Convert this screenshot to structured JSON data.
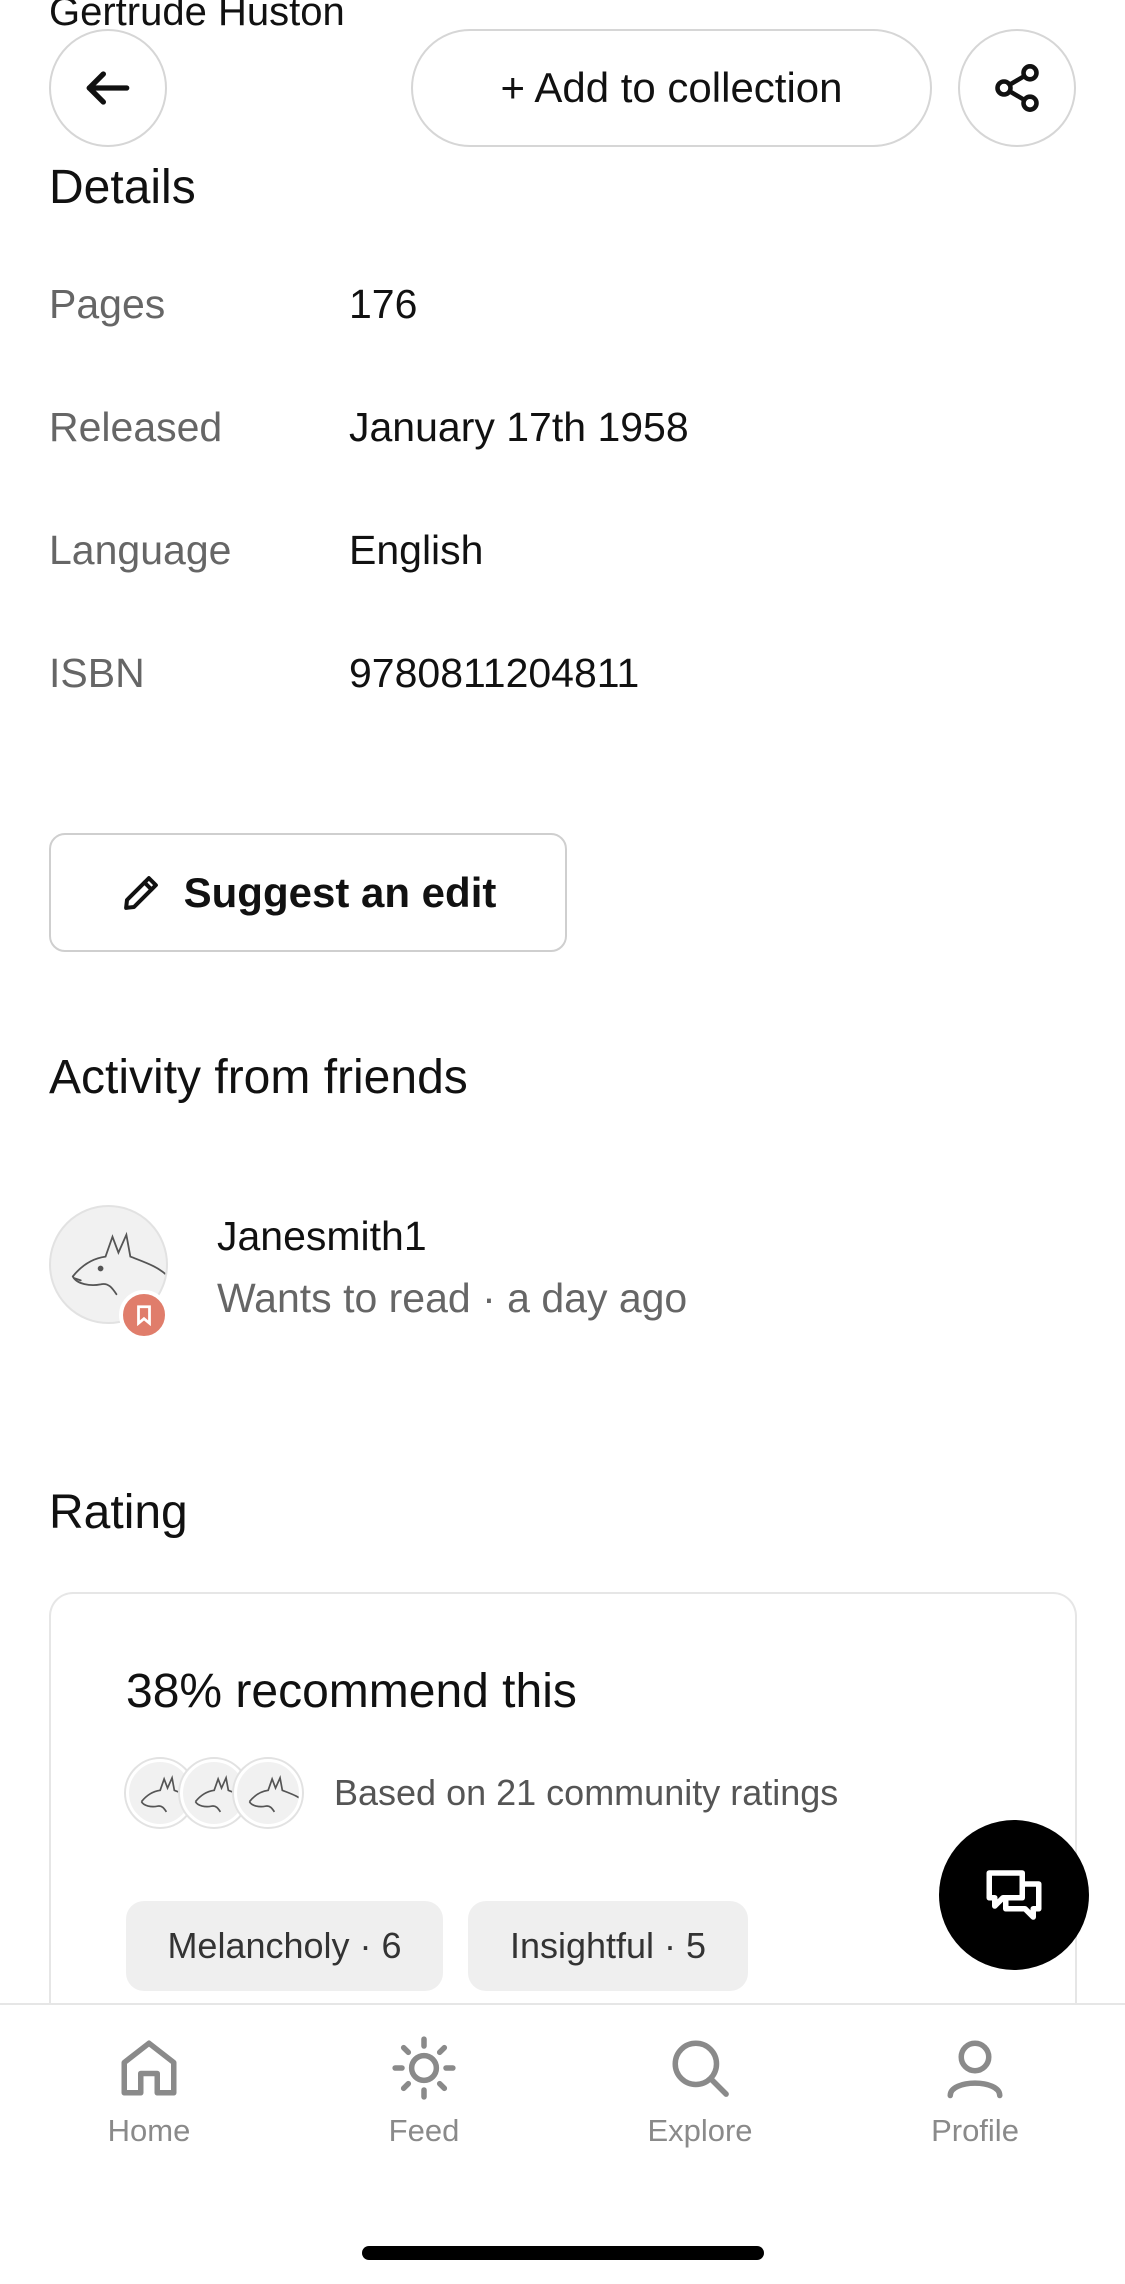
{
  "header": {
    "author": "Gertrude Huston",
    "add_label": "+ Add to collection"
  },
  "details": {
    "title": "Details",
    "rows": [
      {
        "label": "Pages",
        "value": "176"
      },
      {
        "label": "Released",
        "value": "January 17th 1958"
      },
      {
        "label": "Language",
        "value": "English"
      },
      {
        "label": "ISBN",
        "value": "9780811204811"
      }
    ],
    "suggest_label": "Suggest an edit"
  },
  "activity": {
    "title": "Activity from friends",
    "items": [
      {
        "user": "Janesmith1",
        "activity": "Wants to read · a day ago",
        "badge_color": "#e07d6b"
      }
    ]
  },
  "rating": {
    "title": "Rating",
    "recommend": "38% recommend this",
    "based_on": "Based on 21 community ratings",
    "tags": [
      "Melancholy · 6",
      "Insightful · 5"
    ]
  },
  "tabbar": {
    "items": [
      {
        "label": "Home",
        "icon": "home-icon"
      },
      {
        "label": "Feed",
        "icon": "sun-icon"
      },
      {
        "label": "Explore",
        "icon": "search-icon"
      },
      {
        "label": "Profile",
        "icon": "person-icon"
      }
    ]
  },
  "colors": {
    "accent_badge": "#e07d6b",
    "fab": "#000000",
    "muted_text": "#666666",
    "tab_inactive": "#8a8a8a"
  }
}
